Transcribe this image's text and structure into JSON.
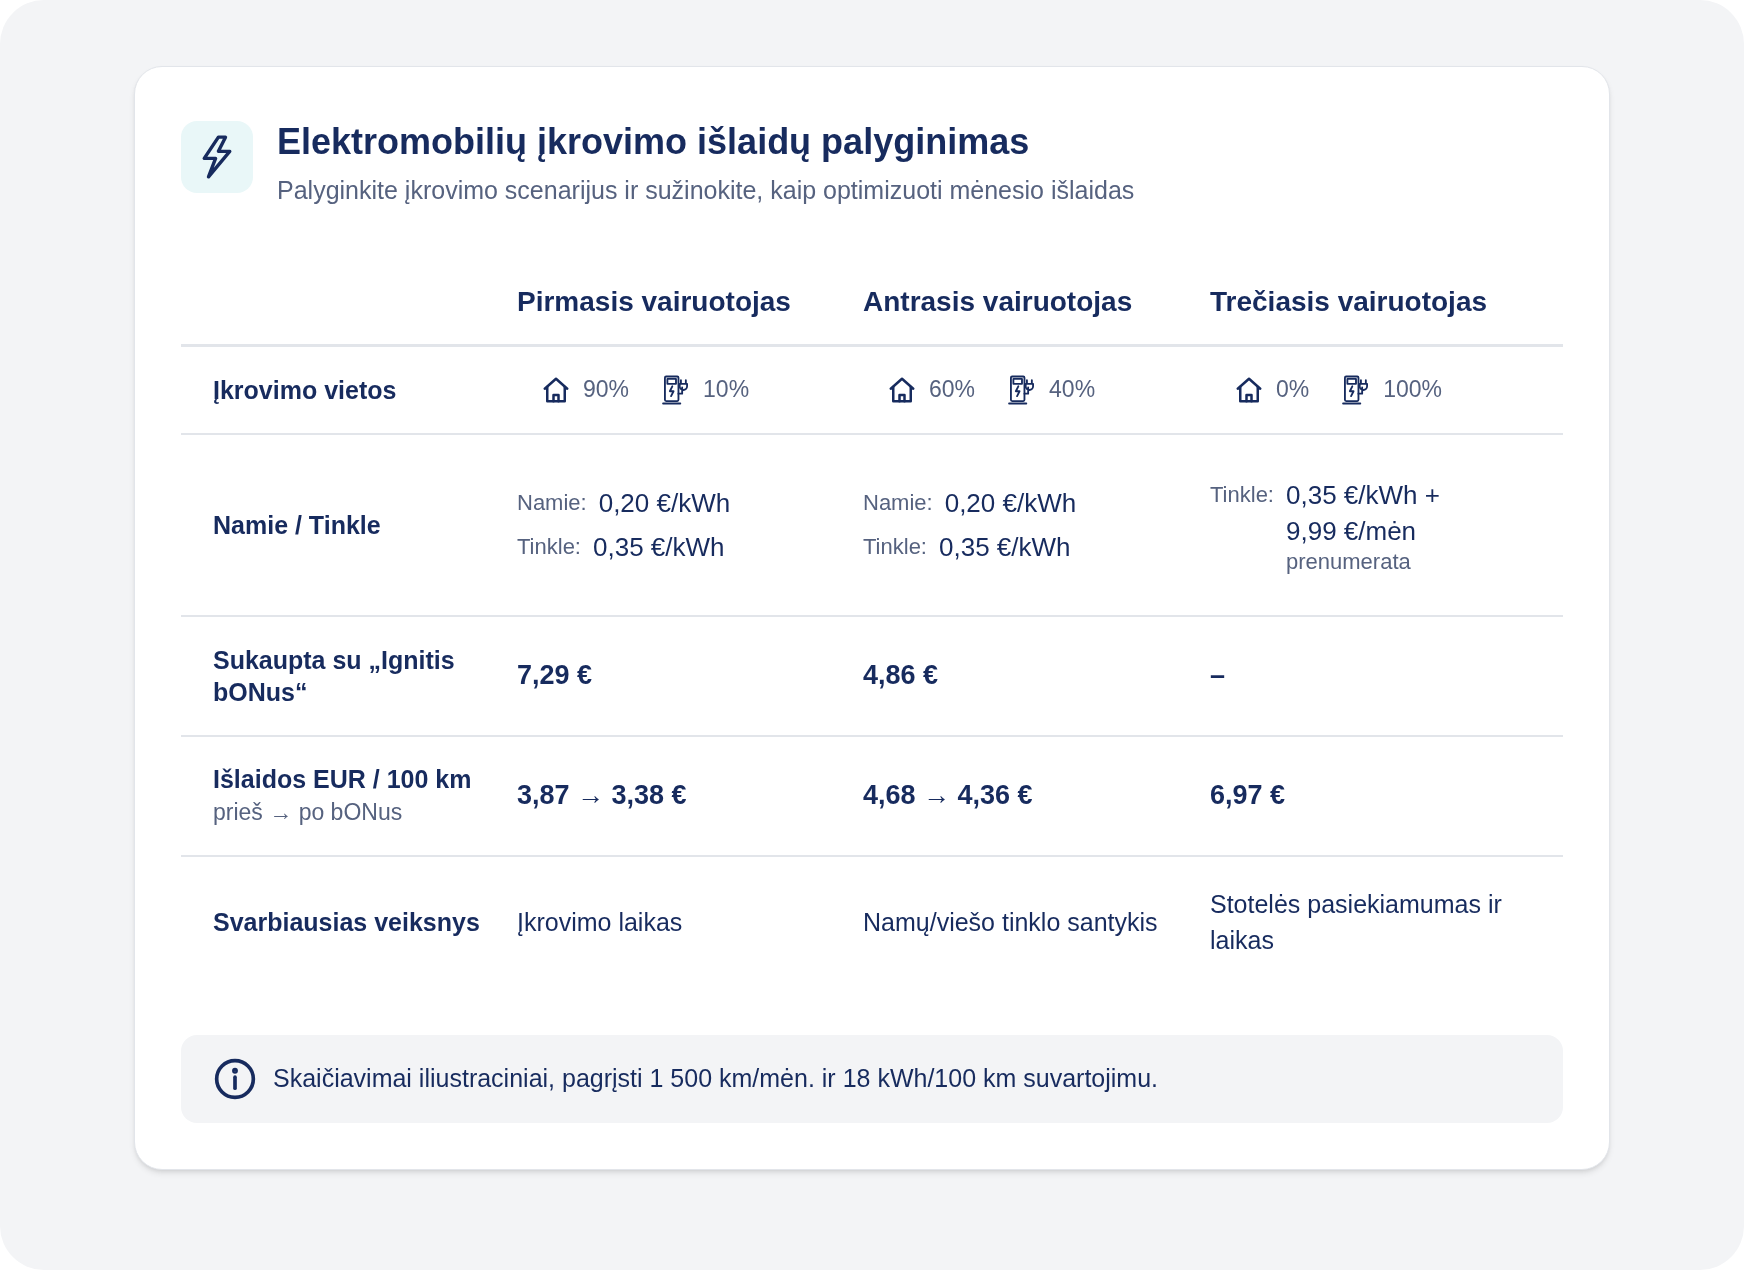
{
  "header": {
    "title": "Elektromobilių įkrovimo išlaidų palyginimas",
    "subtitle": "Palyginkite įkrovimo scenarijus ir sužinokite, kaip optimizuoti mėnesio išlaidas"
  },
  "table": {
    "columns": [
      "Pirmasis vairuotojas",
      "Antrasis vairuotojas",
      "Trečiasis vairuotojas"
    ],
    "rows": [
      {
        "kind": "locations",
        "label": "Įkrovimo vietos",
        "cells": [
          {
            "home": "90%",
            "network": "10%"
          },
          {
            "home": "60%",
            "network": "40%"
          },
          {
            "home": "0%",
            "network": "100%"
          }
        ]
      },
      {
        "kind": "rates",
        "label": "Namie / Tinkle",
        "cells": [
          {
            "lines": [
              {
                "label": "Namie:",
                "value": "0,20 €/kWh"
              },
              {
                "label": "Tinkle:",
                "value": "0,35 €/kWh"
              }
            ]
          },
          {
            "lines": [
              {
                "label": "Namie:",
                "value": "0,20 €/kWh"
              },
              {
                "label": "Tinkle:",
                "value": "0,35 €/kWh"
              }
            ]
          },
          {
            "lines": [
              {
                "label": "Tinkle:",
                "value": "0,35 €/kWh + 9,99 €/mėn",
                "note": "prenumerata"
              }
            ]
          }
        ]
      },
      {
        "kind": "amount",
        "label": "Sukaupta su „Ignitis bONus“",
        "cells": [
          "7,29 €",
          "4,86 €",
          "–"
        ]
      },
      {
        "kind": "amount",
        "label": "Išlaidos EUR / 100 km",
        "sublabel": "prieš → po bONus",
        "cells": [
          "3,87 → 3,38 €",
          "4,68 → 4,36 €",
          "6,97 €"
        ]
      },
      {
        "kind": "text",
        "label": "Svarbiausias veiksnys",
        "cells": [
          "Įkrovimo laikas",
          "Namų/viešo tinklo santykis",
          "Stotelės pasiekiamumas ir laikas"
        ]
      }
    ]
  },
  "note": "Skaičiavimai iliustraciniai, pagrįsti 1 500 km/mėn. ir 18 kWh/100 km suvartojimu."
}
